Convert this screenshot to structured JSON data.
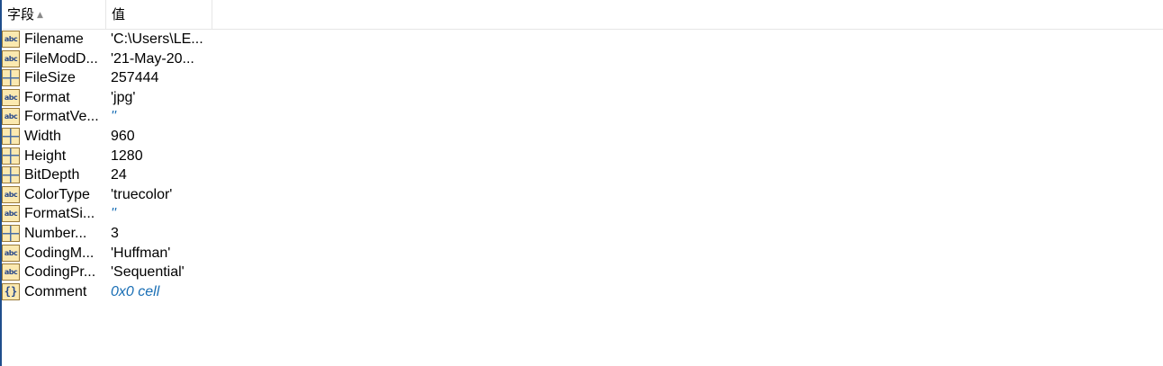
{
  "header": {
    "field_label": "字段",
    "sort_indicator": "▲",
    "value_label": "值"
  },
  "rows": [
    {
      "name": "Filename",
      "value": "'C:\\Users\\LE...",
      "type": "char",
      "value_style": "normal"
    },
    {
      "name": "FileModD...",
      "value": "'21-May-20...",
      "type": "char",
      "value_style": "normal"
    },
    {
      "name": "FileSize",
      "value": "257444",
      "type": "numeric",
      "value_style": "normal"
    },
    {
      "name": "Format",
      "value": "'jpg'",
      "type": "char",
      "value_style": "normal"
    },
    {
      "name": "FormatVe...",
      "value": "''",
      "type": "char",
      "value_style": "blue"
    },
    {
      "name": "Width",
      "value": "960",
      "type": "numeric",
      "value_style": "normal"
    },
    {
      "name": "Height",
      "value": "1280",
      "type": "numeric",
      "value_style": "normal"
    },
    {
      "name": "BitDepth",
      "value": "24",
      "type": "numeric",
      "value_style": "normal"
    },
    {
      "name": "ColorType",
      "value": "'truecolor'",
      "type": "char",
      "value_style": "normal"
    },
    {
      "name": "FormatSi...",
      "value": "''",
      "type": "char",
      "value_style": "blue"
    },
    {
      "name": "Number...",
      "value": "3",
      "type": "numeric",
      "value_style": "normal"
    },
    {
      "name": "CodingM...",
      "value": "'Huffman'",
      "type": "char",
      "value_style": "normal"
    },
    {
      "name": "CodingPr...",
      "value": "'Sequential'",
      "type": "char",
      "value_style": "normal"
    },
    {
      "name": "Comment",
      "value": "0x0 cell",
      "type": "cell",
      "value_style": "blue"
    }
  ],
  "icons": {
    "char": {
      "name": "char-type-icon",
      "glyph": "abc"
    },
    "numeric": {
      "name": "numeric-type-icon",
      "glyph": ""
    },
    "cell": {
      "name": "cell-type-icon",
      "glyph": "{}"
    }
  },
  "colors": {
    "blue_value": "#1a6fb5",
    "left_edge": "#1f4e8c"
  }
}
